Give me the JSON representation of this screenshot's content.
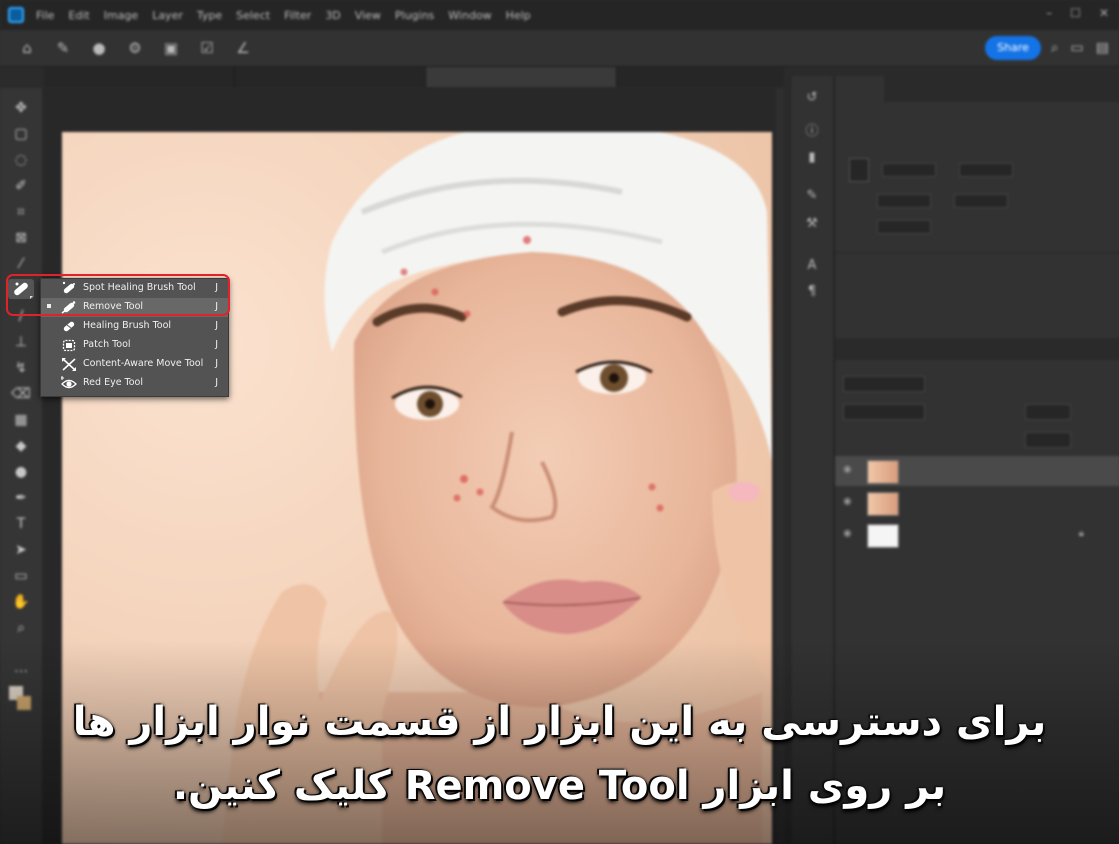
{
  "menubar": {
    "items": [
      "File",
      "Edit",
      "Image",
      "Layer",
      "Type",
      "Select",
      "Filter",
      "3D",
      "View",
      "Plugins",
      "Window",
      "Help"
    ]
  },
  "optbar": {
    "share_label": "Share"
  },
  "flyout": {
    "items": [
      {
        "label": "Spot Healing Brush Tool",
        "key": "J",
        "icon": "spot-healing-brush-icon"
      },
      {
        "label": "Remove Tool",
        "key": "J",
        "icon": "remove-tool-icon",
        "active": true
      },
      {
        "label": "Healing Brush Tool",
        "key": "J",
        "icon": "healing-brush-icon"
      },
      {
        "label": "Patch Tool",
        "key": "J",
        "icon": "patch-icon"
      },
      {
        "label": "Content-Aware Move Tool",
        "key": "J",
        "icon": "content-aware-move-icon"
      },
      {
        "label": "Red Eye Tool",
        "key": "J",
        "icon": "red-eye-icon"
      }
    ]
  },
  "caption": {
    "line1": "برای دسترسی به این ابزار از قسمت نوار ابزار ها",
    "line2": "بر روی ابزار Remove Tool کلیک کنین."
  },
  "colors": {
    "highlight": "#e0222a",
    "accent": "#1473e6",
    "blemish": "#d9534f"
  }
}
